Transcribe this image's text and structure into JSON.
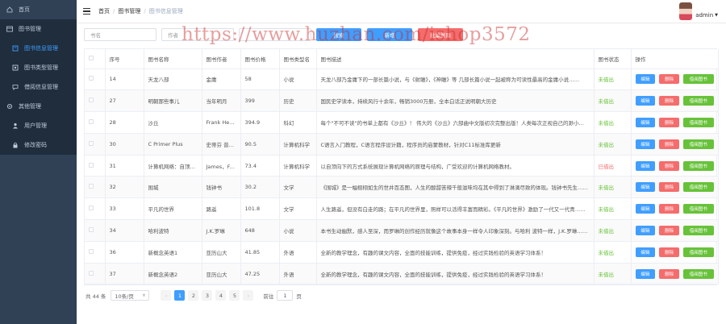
{
  "sidebar": {
    "home": "首页",
    "groups": [
      {
        "label": "图书管理",
        "items": [
          "图书信息管理",
          "图书类型管理",
          "借阅信息管理"
        ]
      },
      {
        "label": "其他管理",
        "items": [
          "用户管理",
          "修改密码"
        ]
      }
    ]
  },
  "header": {
    "breadcrumb": [
      "首页",
      "图书管理",
      "图书信息管理"
    ],
    "username": "admin"
  },
  "toolbar": {
    "name_placeholder": "书名",
    "author_placeholder": "作者",
    "search_label": "搜索",
    "add_label": "新增",
    "batch_label": "批量删除"
  },
  "table": {
    "headers": [
      "序号",
      "图书名称",
      "图书作者",
      "图书价格",
      "图书类型名",
      "图书描述",
      "图书状态",
      "操作"
    ],
    "rows": [
      {
        "id": "14",
        "name": "天龙八部",
        "author": "金庸",
        "price": "58",
        "type": "小说",
        "desc": "天龙八部乃金庸下的一部长篇小说，与《射雕》，《神雕》等 几部长篇小说一起被称为可读性最高的金庸小说……",
        "status": "未借出",
        "out": false
      },
      {
        "id": "27",
        "name": "明朝那些事儿",
        "author": "当年明月",
        "price": "399",
        "type": "历史",
        "desc": "国民史学读本，持续风行十余年，畅销3000万册，全本白话正说明朝大历史",
        "status": "未借出",
        "out": false
      },
      {
        "id": "28",
        "name": "沙丘",
        "author": "Frank Herbert",
        "price": "394.9",
        "type": "科幻",
        "desc": "每个\"不可不读\"的书单上都有《沙丘》！ 伟大的《沙丘》六部曲中文版初次完整出版！人类每次正视自己的渺小……",
        "status": "未借出",
        "out": false
      },
      {
        "id": "30",
        "name": "C Primer Plus",
        "author": "史蒂芬 普拉达",
        "price": "90.5",
        "type": "计算机科学",
        "desc": "C语言入门教程，C语言程序设计籍，程序员的启蒙教材，针对C11标准库更新",
        "status": "未借出",
        "out": false
      },
      {
        "id": "31",
        "name": "计算机网络：自顶向下方法",
        "author": "James，F.Kurose",
        "price": "73.4",
        "type": "计算机科学",
        "desc": "以自顶向下的方式系统展现计算机网络的原理与结构，广受欢迎的计算机网络教材。",
        "status": "已借出",
        "out": true
      },
      {
        "id": "32",
        "name": "围城",
        "author": "钱钟书",
        "price": "30.2",
        "type": "文学",
        "desc": "《围城》是一幅栩栩如生的世井百态图，人生的酸甜苦辣千般滋味均在其中得到了淋漓尽致的体现。钱钟书先生……",
        "status": "未借出",
        "out": false
      },
      {
        "id": "33",
        "name": "平凡的世界",
        "author": "路遥",
        "price": "101.8",
        "type": "文学",
        "desc": "人生路遥，但没有白走的路；在平凡的世界里，照样可以活得丰富而精彩。《平凡的世界》激励了一代又一代青……",
        "status": "未借出",
        "out": false
      },
      {
        "id": "34",
        "name": "哈利波特",
        "author": "J.K.罗琳",
        "price": "648",
        "type": "小说",
        "desc": "本书生动幽默，感人至深，而罗琳的创作经历就像这个故事本身一样令人印象深刻。与哈利 波特一样，J.K.罗琳……",
        "status": "未借出",
        "out": false
      },
      {
        "id": "36",
        "name": "新概念英语1",
        "author": "亚历山大",
        "price": "41.85",
        "type": "外语",
        "desc": "全新的教学理念，有趣的课文内容，全面的技能训练，提供免疫，经过实践检验的英语学习体系！",
        "status": "未借出",
        "out": false
      },
      {
        "id": "37",
        "name": "新概念英语2",
        "author": "亚历山大",
        "price": "47.25",
        "type": "外语",
        "desc": "全新的教学理念，有趣的课文内容，全面的技能训练，提供免疫，经过实践检验的英语学习体系！",
        "status": "未借出",
        "out": false
      }
    ],
    "edit_label": "编辑",
    "delete_label": "删除",
    "borrow_label": "借阅图书"
  },
  "pagination": {
    "total": "共 44 条",
    "page_size": "10条/页",
    "pages": [
      "1",
      "2",
      "3",
      "4",
      "5"
    ],
    "goto_prefix": "前往",
    "goto_value": "1",
    "goto_suffix": "页"
  },
  "watermark": "https://www.huzhan.com/ishop3572",
  "colors": {
    "primary": "#409eff",
    "danger": "#f56c6c",
    "success": "#67c23a",
    "sidebar": "#304156"
  }
}
